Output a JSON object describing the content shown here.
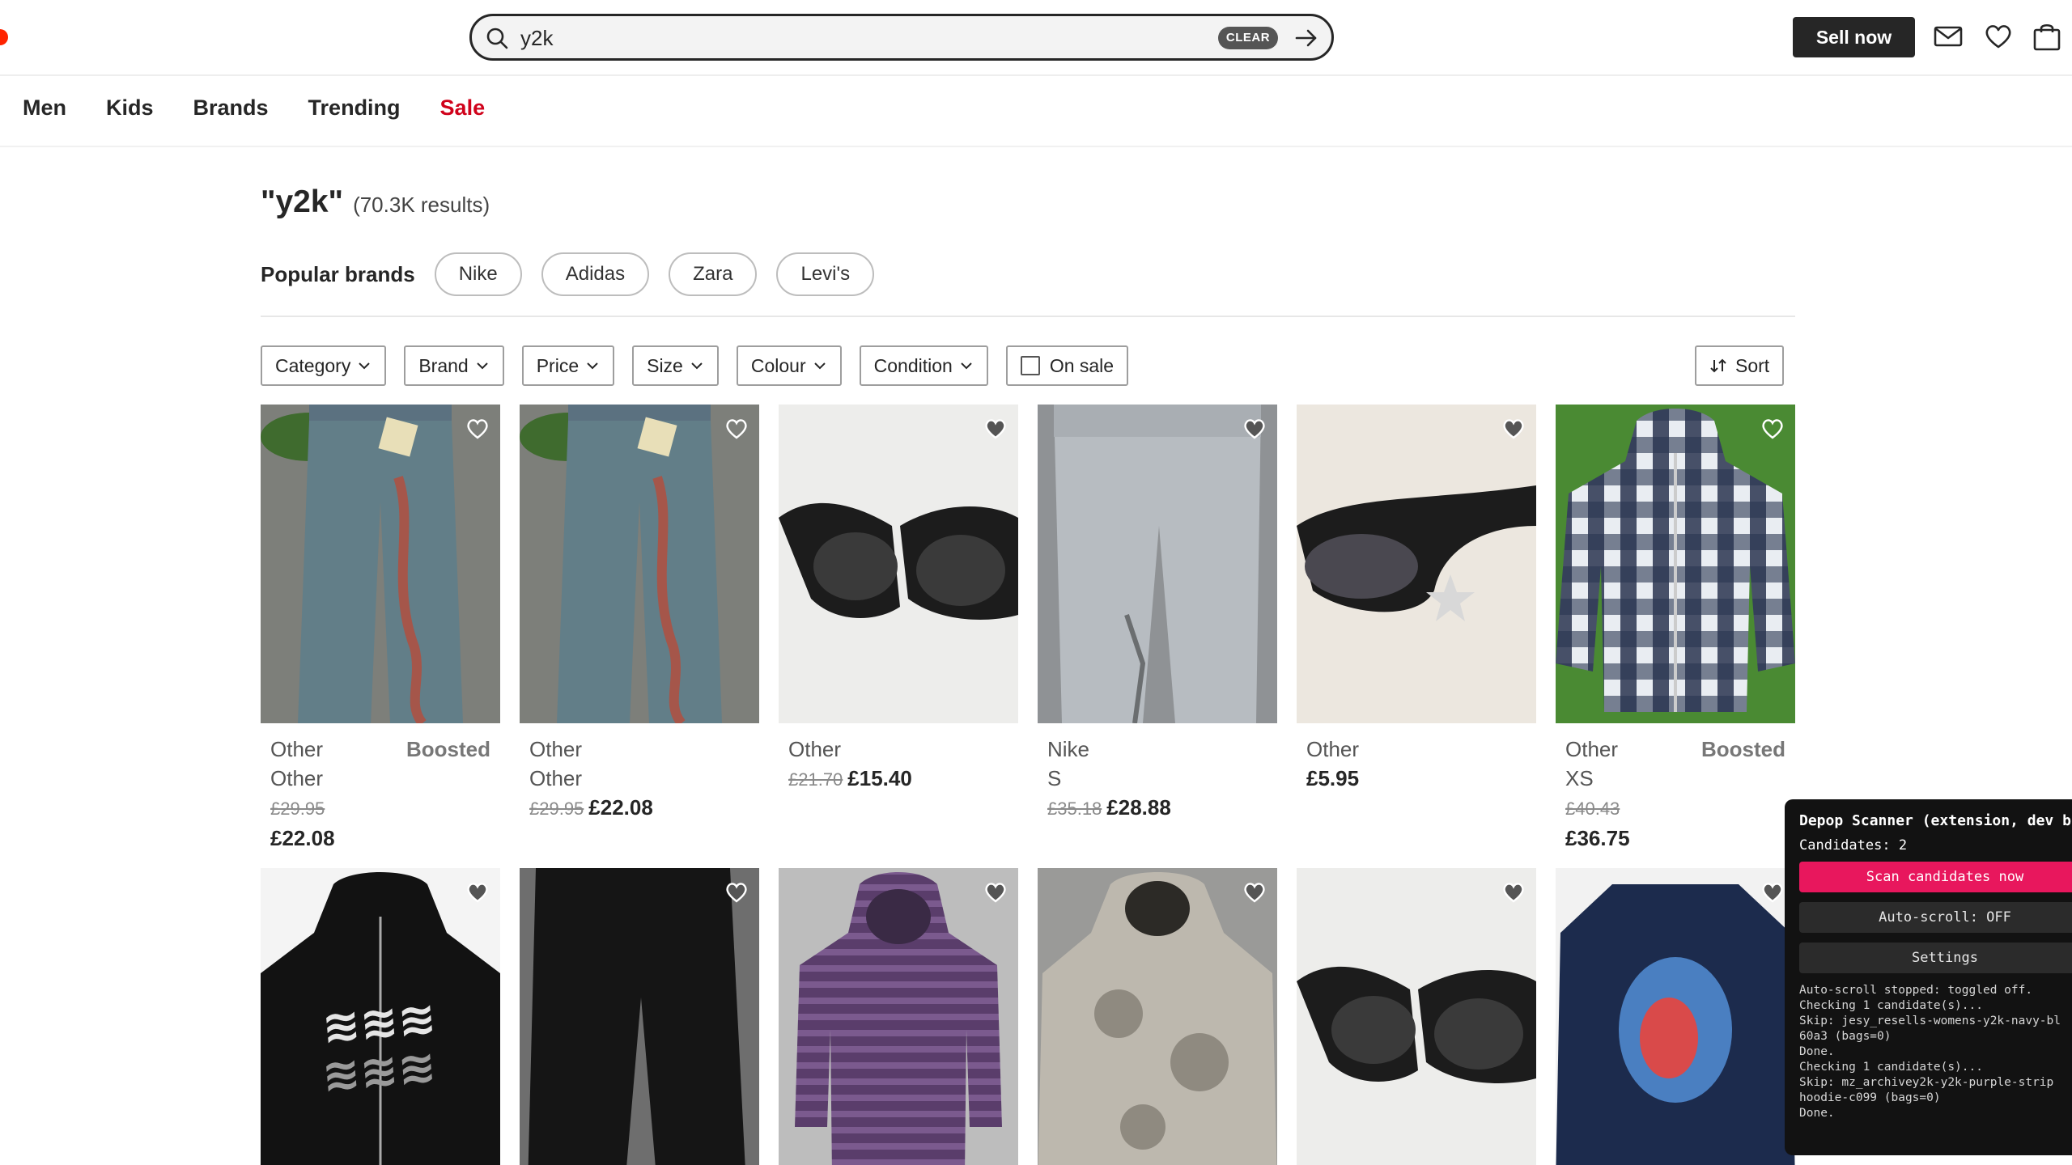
{
  "header": {
    "search_value": "y2k",
    "clear_label": "CLEAR",
    "sell_label": "Sell now",
    "brand_color": "#ff2300"
  },
  "nav": {
    "items": [
      "Men",
      "Kids",
      "Brands",
      "Trending",
      "Sale"
    ]
  },
  "results": {
    "query": "\"y2k\"",
    "count": "(70.3K results)"
  },
  "popular_brands": {
    "label": "Popular brands",
    "chips": [
      "Nike",
      "Adidas",
      "Zara",
      "Levi's"
    ]
  },
  "filters": {
    "items": [
      "Category",
      "Brand",
      "Price",
      "Size",
      "Colour",
      "Condition"
    ],
    "on_sale": "On sale",
    "sort": "Sort"
  },
  "products": [
    {
      "brand": "Other",
      "boosted": "Boosted",
      "size": "Other",
      "orig": "£29.95",
      "price": "£22.08",
      "icon": "baggy-jeans"
    },
    {
      "brand": "Other",
      "boosted": "",
      "size": "Other",
      "orig": "£29.95",
      "price": "£22.08",
      "icon": "baggy-jeans"
    },
    {
      "brand": "Other",
      "boosted": "",
      "size": "",
      "orig": "£21.70",
      "price": "£15.40",
      "icon": "sunglasses"
    },
    {
      "brand": "Nike",
      "boosted": "",
      "size": "S",
      "orig": "£35.18",
      "price": "£28.88",
      "icon": "joggers"
    },
    {
      "brand": "Other",
      "boosted": "",
      "size": "",
      "orig": "",
      "price": "£5.95",
      "icon": "star-sunglasses"
    },
    {
      "brand": "Other",
      "boosted": "Boosted",
      "size": "XS",
      "orig": "£40.43",
      "price": "£36.75",
      "icon": "check-hoodie"
    },
    {
      "icon": "black-hoodie"
    },
    {
      "icon": "black-trousers"
    },
    {
      "icon": "striped-hoodie"
    },
    {
      "icon": "camo-hoodie"
    },
    {
      "icon": "sunglasses"
    },
    {
      "icon": "graphic-top"
    }
  ],
  "extension": {
    "title": "Depop Scanner (extension, dev b",
    "candidates": "Candidates: 2",
    "scan_label": "Scan candidates now",
    "autoscroll_label": "Auto-scroll: OFF",
    "settings_label": "Settings",
    "log": [
      "Auto-scroll stopped: toggled off.",
      "Checking 1 candidate(s)...",
      "Skip: jesy_resells-womens-y2k-navy-bl",
      "60a3 (bags=0)",
      "Done.",
      "Checking 1 candidate(s)...",
      "Skip: mz_archivey2k-y2k-purple-strip",
      "hoodie-c099 (bags=0)",
      "Done."
    ],
    "accent": "#e8175d"
  }
}
